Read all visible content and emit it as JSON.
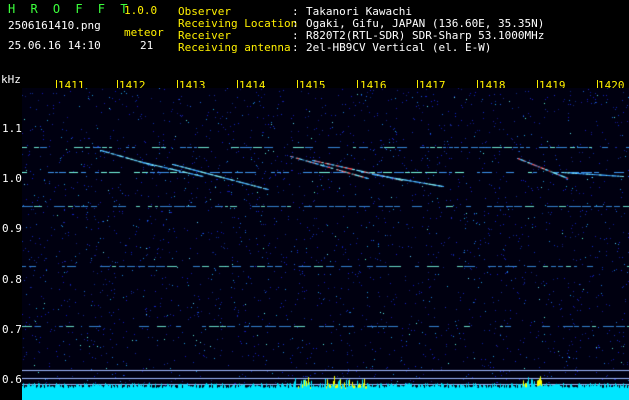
{
  "header": {
    "app_name": "H R O F F T",
    "version": "1.0.0",
    "filename": "2506161410.png",
    "meteor_label": "meteor",
    "timestamp": "25.06.16 14:10",
    "meteor_count": "21"
  },
  "meta": [
    {
      "label": "Observer",
      "value": "Takanori Kawachi"
    },
    {
      "label": "Receiving Location",
      "value": "Ogaki, Gifu, JAPAN (136.60E, 35.35N)"
    },
    {
      "label": "Receiver",
      "value": "R820T2(RTL-SDR) SDR-Sharp 53.1000MHz"
    },
    {
      "label": "Receiving antenna",
      "value": "2el-HB9CV Vertical (el. E-W)"
    }
  ],
  "axis": {
    "unit_label": "kHz",
    "time_ticks": [
      "1411",
      "1412",
      "1413",
      "1414",
      "1415",
      "1416",
      "1417",
      "1418",
      "1419",
      "1420"
    ],
    "freq_ticks": [
      "1.1",
      "1.0",
      "0.9",
      "0.8",
      "0.7",
      "0.6"
    ]
  },
  "colors": {
    "background": "#000000",
    "noise": "#0a1ca0",
    "title": "#3cff3c",
    "ticks": "#fff000",
    "text": "#ffffff",
    "baseline": "#00e6ff",
    "hot": "#ffff00"
  }
}
